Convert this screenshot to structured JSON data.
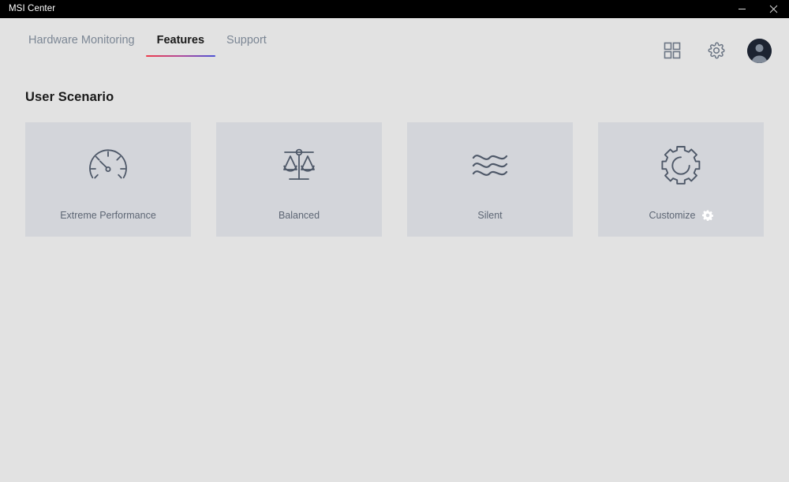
{
  "window": {
    "title": "MSI Center",
    "minimize_label": "Minimize",
    "close_label": "Close"
  },
  "nav": {
    "tabs": [
      {
        "label": "Hardware Monitoring",
        "active": false
      },
      {
        "label": "Features",
        "active": true
      },
      {
        "label": "Support",
        "active": false
      }
    ],
    "actions": [
      {
        "icon": "apps-grid-icon",
        "label": "Apps"
      },
      {
        "icon": "gear-icon",
        "label": "Settings"
      },
      {
        "icon": "avatar-icon",
        "label": "Account"
      }
    ],
    "active_underline_from": "#ef3b4a",
    "active_underline_to": "#4b52d6"
  },
  "main": {
    "section_title": "User Scenario",
    "cards": [
      {
        "label": "Extreme Performance",
        "icon": "gauge-icon",
        "badge": null
      },
      {
        "label": "Balanced",
        "icon": "scales-icon",
        "badge": null
      },
      {
        "label": "Silent",
        "icon": "waves-icon",
        "badge": null
      },
      {
        "label": "Customize",
        "icon": "gear-large-icon",
        "badge": "gear-badge-icon"
      }
    ]
  },
  "colors": {
    "page_background": "#e2e2e2",
    "card_background": "#d3d5da",
    "titlebar_background": "#000000",
    "active_tab_text": "#1a1a1a",
    "inactive_tab_text": "#7b8694",
    "icon_color": "#4e5868",
    "label_color": "#5d6674"
  }
}
